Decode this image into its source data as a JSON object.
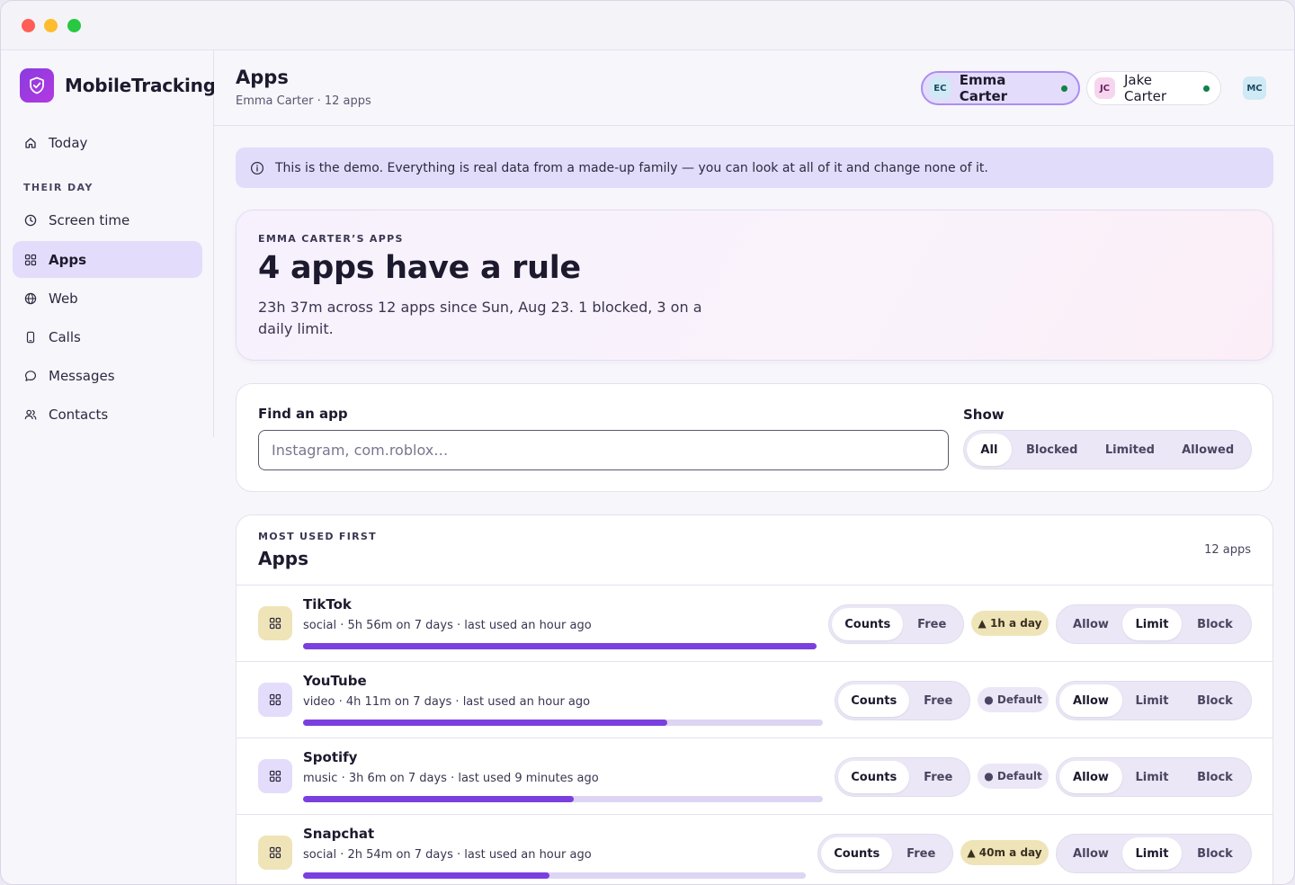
{
  "app": {
    "name": "MobileTracking"
  },
  "sidebar": {
    "section_label": "THEIR DAY",
    "items": [
      {
        "label": "Today",
        "icon": "home-icon"
      },
      {
        "label": "Screen time",
        "icon": "clock-icon"
      },
      {
        "label": "Apps",
        "icon": "grid-icon",
        "active": true
      },
      {
        "label": "Web",
        "icon": "globe-icon"
      },
      {
        "label": "Calls",
        "icon": "phone-icon"
      },
      {
        "label": "Messages",
        "icon": "message-icon"
      },
      {
        "label": "Contacts",
        "icon": "contacts-icon"
      }
    ]
  },
  "header": {
    "title": "Apps",
    "subtitle": "Emma Carter · 12 apps",
    "people": [
      {
        "initials": "EC",
        "name": "Emma Carter",
        "active": true
      },
      {
        "initials": "JC",
        "name": "Jake Carter",
        "active": false
      },
      {
        "initials": "MC"
      }
    ]
  },
  "banner": {
    "text": "This is the demo. Everything is real data from a made-up family — you can look at all of it and change none of it."
  },
  "hero": {
    "eyebrow": "EMMA CARTER’S APPS",
    "title": "4 apps have a rule",
    "description": "23h 37m across 12 apps since Sun, Aug 23. 1 blocked, 3 on a daily limit."
  },
  "filter": {
    "search_label": "Find an app",
    "search_placeholder": "Instagram, com.roblox…",
    "search_value": "",
    "show_label": "Show",
    "options": [
      "All",
      "Blocked",
      "Limited",
      "Allowed"
    ],
    "selected": "All"
  },
  "apps_list": {
    "eyebrow": "MOST USED FIRST",
    "title": "Apps",
    "count": "12 apps",
    "count_options": [
      "Counts",
      "Free"
    ],
    "rule_options": [
      "Allow",
      "Limit",
      "Block"
    ],
    "rows": [
      {
        "name": "TikTok",
        "meta": "social · 5h 56m on 7 days · last used an hour ago",
        "usage_fraction": 1.0,
        "counts": "Counts",
        "badge": "▲ 1h a day",
        "badge_type": "limit",
        "rule": "Limit"
      },
      {
        "name": "YouTube",
        "meta": "video · 4h 11m on 7 days · last used an hour ago",
        "usage_fraction": 0.7,
        "counts": "Counts",
        "badge": "● Default",
        "badge_type": "default",
        "rule": "Allow"
      },
      {
        "name": "Spotify",
        "meta": "music · 3h 6m on 7 days · last used 9 minutes ago",
        "usage_fraction": 0.52,
        "counts": "Counts",
        "badge": "● Default",
        "badge_type": "default",
        "rule": "Allow"
      },
      {
        "name": "Snapchat",
        "meta": "social · 2h 54m on 7 days · last used an hour ago",
        "usage_fraction": 0.49,
        "counts": "Counts",
        "badge": "▲ 40m a day",
        "badge_type": "limit",
        "rule": "Limit"
      }
    ]
  },
  "colors": {
    "accent": "#7b3fe0",
    "active_bg": "#e4dcfb",
    "online": "#13804a",
    "limit_badge": "#efe4b8"
  }
}
